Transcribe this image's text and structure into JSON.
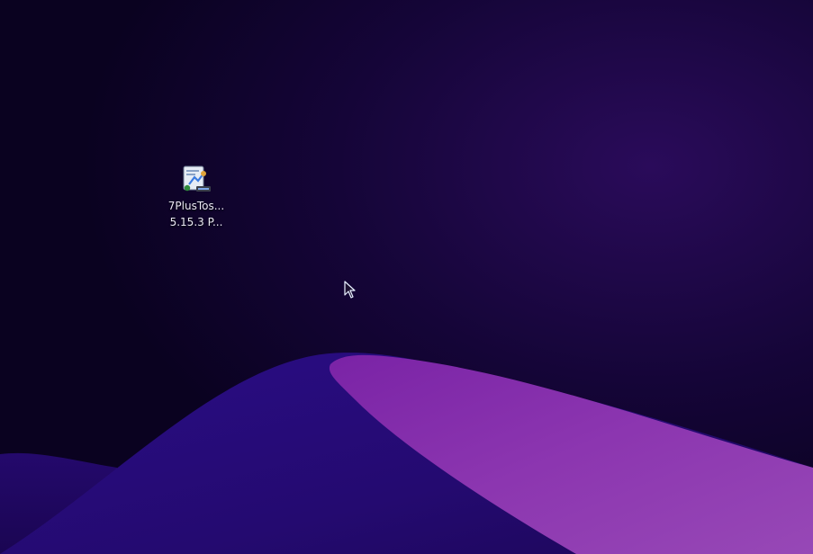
{
  "desktop": {
    "background_color": "#0c0326",
    "icons": [
      {
        "label_line1": "7PlusTos...",
        "label_line2": "5.15.3 P...",
        "icon": "installer-app-icon"
      }
    ]
  },
  "cursor": {
    "icon": "arrow-cursor-icon"
  }
}
